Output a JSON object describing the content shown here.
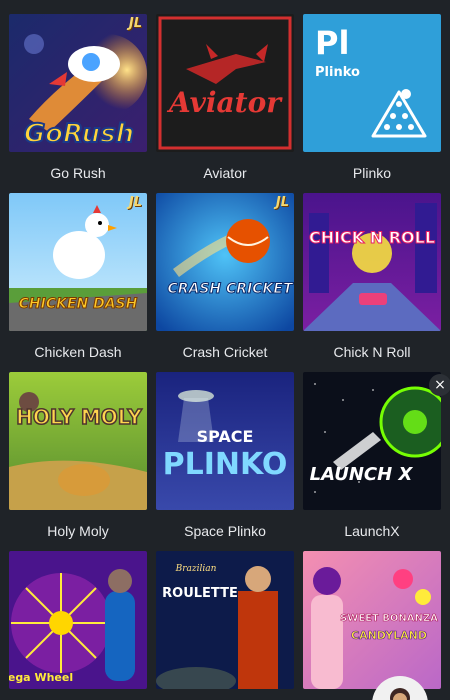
{
  "games": [
    {
      "title": "Go Rush",
      "logo_text": "GoRush",
      "badge": "JL",
      "accent": "#f6a821"
    },
    {
      "title": "Aviator",
      "logo_text": "Aviator",
      "badge": "",
      "accent": "#e8271f"
    },
    {
      "title": "Plinko",
      "logo_text": "Pl",
      "sub_text": "Plinko",
      "badge": "",
      "accent": "#2f9fd9"
    },
    {
      "title": "Chicken Dash",
      "logo_text": "CHICKEN DASH",
      "badge": "JL",
      "accent": "#f2b320"
    },
    {
      "title": "Crash Cricket",
      "logo_text": "CRASH CRICKET",
      "badge": "JL",
      "accent": "#1565c0"
    },
    {
      "title": "Chick N Roll",
      "logo_text": "CHICK N ROLL",
      "badge": "",
      "accent": "#7b2cbf"
    },
    {
      "title": "Holy Moly",
      "logo_text": "HOLY MOLY",
      "badge": "",
      "accent": "#7cb518"
    },
    {
      "title": "Space Plinko",
      "logo_text_top": "SPACE",
      "logo_text": "PLINKO",
      "badge": "",
      "accent": "#3a4aa8"
    },
    {
      "title": "LaunchX",
      "logo_text": "LAUNCH X",
      "badge": "",
      "accent": "#4caf50"
    },
    {
      "title": "",
      "logo_text": "Mega Wheel",
      "badge": "",
      "accent": "#6a1b9a"
    },
    {
      "title": "",
      "logo_text_top": "Brazilian",
      "logo_text": "ROULETTE",
      "badge": "",
      "accent": "#1a237e"
    },
    {
      "title": "",
      "logo_text_top": "SWEET BONANZA",
      "logo_text": "CANDYLAND",
      "badge": "",
      "accent": "#e040a0"
    }
  ],
  "close_icon": "close-icon",
  "close_glyph": "×"
}
